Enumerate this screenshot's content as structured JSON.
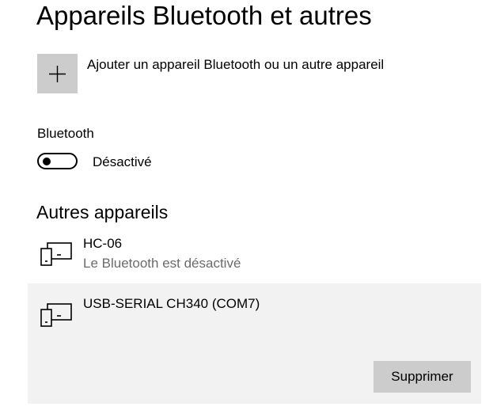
{
  "header": {
    "title": "Appareils Bluetooth et autres"
  },
  "add_device": {
    "label": "Ajouter un appareil Bluetooth ou un autre appareil",
    "icon": "plus-icon"
  },
  "bluetooth": {
    "label": "Bluetooth",
    "state_label": "Désactivé",
    "enabled": false
  },
  "other_devices": {
    "title": "Autres appareils",
    "items": [
      {
        "name": "HC-06",
        "status": "Le Bluetooth est désactivé",
        "icon": "device-icon"
      },
      {
        "name": "USB-SERIAL CH340 (COM7)",
        "icon": "device-icon",
        "selected": true,
        "remove_label": "Supprimer"
      }
    ]
  },
  "colors": {
    "tile_bg": "#cccccc",
    "selected_bg": "#f2f2f2",
    "secondary_text": "#6b6b6b"
  }
}
